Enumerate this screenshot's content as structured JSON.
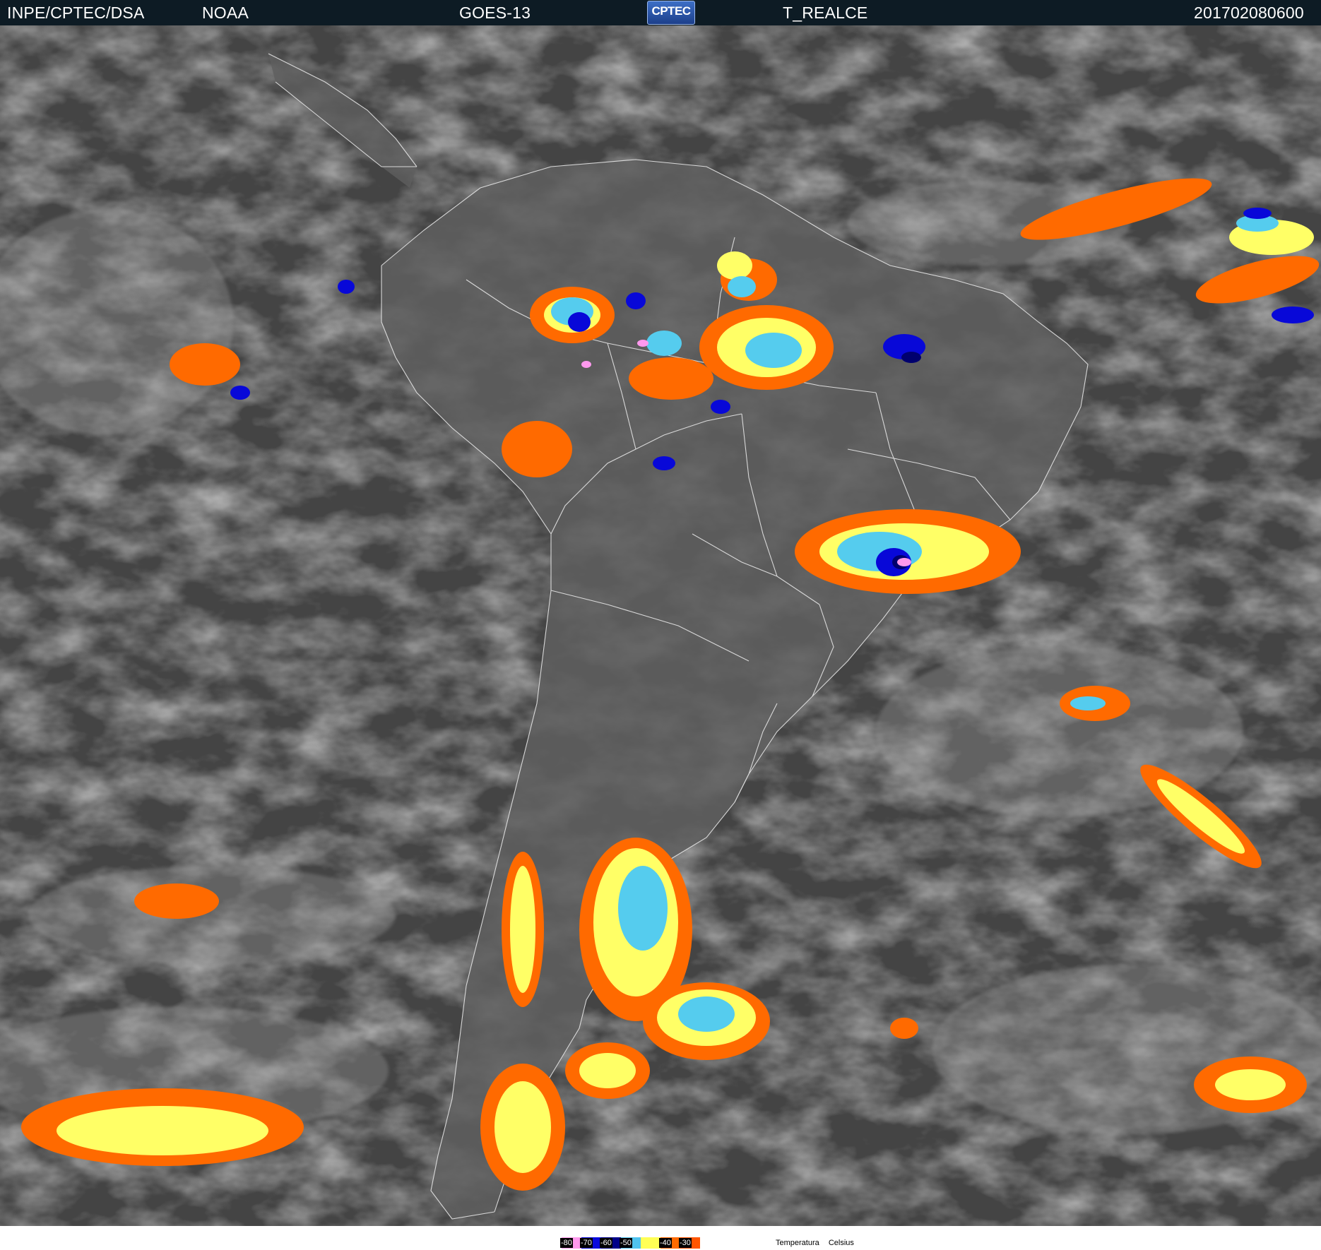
{
  "header": {
    "organization": "INPE/CPTEC/DSA",
    "agency": "NOAA",
    "satellite": "GOES-13",
    "logo_text": "CPTEC",
    "product": "T_REALCE",
    "timestamp": "201702080600"
  },
  "legend": {
    "title": "Temperatura",
    "unit": "Celsius",
    "scale": [
      {
        "label": "-80",
        "color": "#ff99ee"
      },
      {
        "label": "-70",
        "color": "#0a0adc"
      },
      {
        "label": "-60",
        "color": "#000088"
      },
      {
        "label": "-50",
        "color": "#4fc3ee"
      },
      {
        "label": "",
        "color": "#ffff55"
      },
      {
        "label": "-40",
        "color": "#ff6a00"
      },
      {
        "label": "-30",
        "color": "#ff5500"
      }
    ]
  },
  "palette": {
    "ocean": "#454545",
    "land": "#5e5e5e",
    "border": "#e6e6e6",
    "orange": "#ff6a00",
    "yellow": "#ffff66",
    "cyan": "#55ccee",
    "blue": "#0808d8",
    "navy": "#00006e",
    "pink": "#ff99ee"
  }
}
